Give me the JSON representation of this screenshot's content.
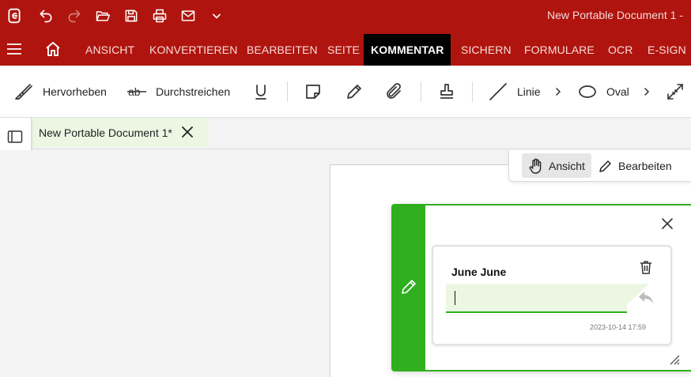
{
  "window": {
    "title": "New Portable Document 1  -"
  },
  "quick_access": [
    "app-logo-icon",
    "undo-icon",
    "redo-icon",
    "open-folder-icon",
    "save-icon",
    "print-icon",
    "mail-icon",
    "chevron-down-icon"
  ],
  "menu": {
    "items": [
      {
        "label": "ANSICHT"
      },
      {
        "label": "KONVERTIEREN"
      },
      {
        "label": "BEARBEITEN"
      },
      {
        "label": "SEITE"
      },
      {
        "label": "KOMMENTAR",
        "active": true
      },
      {
        "label": "SICHERN"
      },
      {
        "label": "FORMULARE"
      },
      {
        "label": "OCR"
      },
      {
        "label": "E-SIGN"
      }
    ]
  },
  "toolbar": {
    "highlight_label": "Hervorheben",
    "strikethrough_label": "Durchstreichen",
    "line_label": "Linie",
    "oval_label": "Oval"
  },
  "tab": {
    "title": "New Portable Document 1*"
  },
  "modes": {
    "view_label": "Ansicht",
    "edit_label": "Bearbeiten"
  },
  "comment": {
    "author": "June June",
    "reply_value": "",
    "timestamp": "2023-10-14 17:59"
  },
  "colors": {
    "brand_red": "#b0140e",
    "active_tab": "#000000",
    "comment_green": "#2fae1e",
    "input_bg": "#ebf7e3"
  }
}
